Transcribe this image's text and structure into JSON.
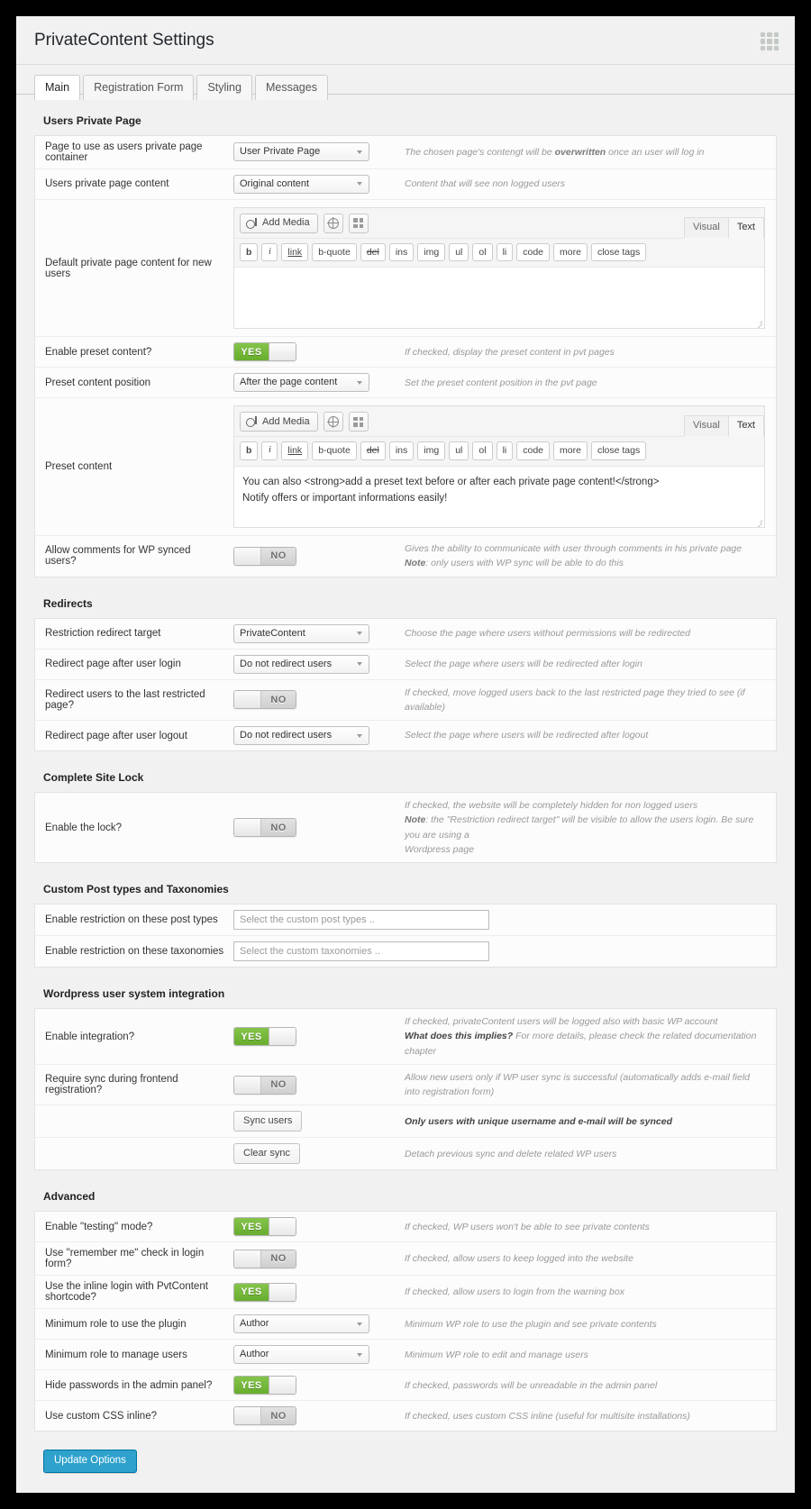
{
  "header": {
    "title": "PrivateContent Settings",
    "grid_icon": "grid-icon"
  },
  "tabs": [
    {
      "label": "Main",
      "active": true
    },
    {
      "label": "Registration Form",
      "active": false
    },
    {
      "label": "Styling",
      "active": false
    },
    {
      "label": "Messages",
      "active": false
    }
  ],
  "editor_toolbar": {
    "add_media_label": "Add Media",
    "globe_icon": "globe-icon",
    "grid_icon": "grid-layout-icon",
    "mode_visual": "Visual",
    "mode_text": "Text",
    "quicktags": [
      "b",
      "i",
      "link",
      "b-quote",
      "del",
      "ins",
      "img",
      "ul",
      "ol",
      "li",
      "code",
      "more",
      "close tags"
    ]
  },
  "toggle_labels": {
    "on": "YES",
    "off": "NO"
  },
  "sections": [
    {
      "title": "Users Private Page",
      "rows": [
        {
          "label": "Page to use as users private page container",
          "control": "select",
          "value": "User Private Page",
          "desc_html": "The chosen page's contengt will be <b>overwritten</b> once an user will log in"
        },
        {
          "label": "Users private page content",
          "control": "select",
          "value": "Original content",
          "desc_html": "Content that will see non logged users"
        },
        {
          "label": "Default private page content for new users",
          "control": "editor",
          "value": "",
          "desc_html": ""
        },
        {
          "label": "Enable preset content?",
          "control": "toggle",
          "value": "YES",
          "desc_html": "If checked, display the preset content in pvt pages"
        },
        {
          "label": "Preset content position",
          "control": "select",
          "value": "After the page content",
          "desc_html": "Set the preset content position in the pvt page"
        },
        {
          "label": "Preset content",
          "control": "editor",
          "value": "You can also <strong>add a preset text before or after each private page content!</strong>\nNotify offers or important informations easily!",
          "desc_html": ""
        },
        {
          "label": "Allow comments for WP synced users?",
          "control": "toggle",
          "value": "NO",
          "desc_html": "Gives the ability to communicate with user through comments in his private page<span class=\"desc-line\"><b>Note</b>: only users with WP sync will be able to do this</span>"
        }
      ]
    },
    {
      "title": "Redirects",
      "rows": [
        {
          "label": "Restriction redirect target",
          "control": "select",
          "value": "PrivateContent",
          "desc_html": "Choose the page where users without permissions will be redirected"
        },
        {
          "label": "Redirect page after user login",
          "control": "select",
          "value": "Do not redirect users",
          "desc_html": "Select the page where users will be redirected after login"
        },
        {
          "label": "Redirect users to the last restricted page?",
          "control": "toggle",
          "value": "NO",
          "desc_html": "If checked, move logged users back to the last restricted page they tried to see (if available)"
        },
        {
          "label": "Redirect page after user logout",
          "control": "select",
          "value": "Do not redirect users",
          "desc_html": "Select the page where users will be redirected after logout"
        }
      ]
    },
    {
      "title": "Complete Site Lock",
      "rows": [
        {
          "label": "Enable the lock?",
          "control": "toggle",
          "value": "NO",
          "desc_html": "If checked, the website will be completely hidden for non logged users<span class=\"desc-line\"><b>Note</b>: the \"Restriction redirect target\" will be visible to allow the users login. Be sure you are using a</span><span class=\"desc-line\">Wordpress page</span>"
        }
      ]
    },
    {
      "title": "Custom Post types and Taxonomies",
      "rows": [
        {
          "label": "Enable restriction on these post types",
          "control": "text",
          "value": "",
          "placeholder": "Select the custom post types ..",
          "desc_html": ""
        },
        {
          "label": "Enable restriction on these taxonomies",
          "control": "text",
          "value": "",
          "placeholder": "Select the custom taxonomies ..",
          "desc_html": ""
        }
      ]
    },
    {
      "title": "Wordpress user system integration",
      "rows": [
        {
          "label": "Enable integration?",
          "control": "toggle",
          "value": "YES",
          "desc_html": "If checked, privateContent users will be logged also with basic WP account<span class=\"desc-line\"><span class=\"strongdark\">What does this implies?</span> For more details, please check the related documentation chapter</span>"
        },
        {
          "label": "Require sync during frontend registration?",
          "control": "toggle",
          "value": "NO",
          "desc_html": "Allow new users only if WP user sync is successful (automatically adds e-mail field into registration form)"
        },
        {
          "label": "",
          "control": "button",
          "value": "Sync users",
          "desc_html": "<span class=\"strongdark\">Only users with unique username and e-mail will be synced</span>"
        },
        {
          "label": "",
          "control": "button",
          "value": "Clear sync",
          "desc_html": "Detach previous sync and delete related WP users"
        }
      ]
    },
    {
      "title": "Advanced",
      "rows": [
        {
          "label": "Enable \"testing\" mode?",
          "control": "toggle",
          "value": "YES",
          "desc_html": "If checked, WP users won't be able to see private contents"
        },
        {
          "label": "Use \"remember me\" check in login form?",
          "control": "toggle",
          "value": "NO",
          "desc_html": "If checked, allow users to keep logged into the website"
        },
        {
          "label": "Use the inline login with PvtContent shortcode?",
          "control": "toggle",
          "value": "YES",
          "desc_html": "If checked, allow users to login from the warning box"
        },
        {
          "label": "Minimum role to use the plugin",
          "control": "select",
          "value": "Author",
          "desc_html": "Minimum WP role to use the plugin and see private contents"
        },
        {
          "label": "Minimum role to manage users",
          "control": "select",
          "value": "Author",
          "desc_html": "Minimum WP role to edit and manage users"
        },
        {
          "label": "Hide passwords in the admin panel?",
          "control": "toggle",
          "value": "YES",
          "desc_html": "If checked, passwords will be unreadable in the admin panel"
        },
        {
          "label": "Use custom CSS inline?",
          "control": "toggle",
          "value": "NO",
          "desc_html": "If checked, uses custom CSS inline (useful for multisite installations)"
        }
      ]
    }
  ],
  "submit": {
    "label": "Update Options"
  }
}
